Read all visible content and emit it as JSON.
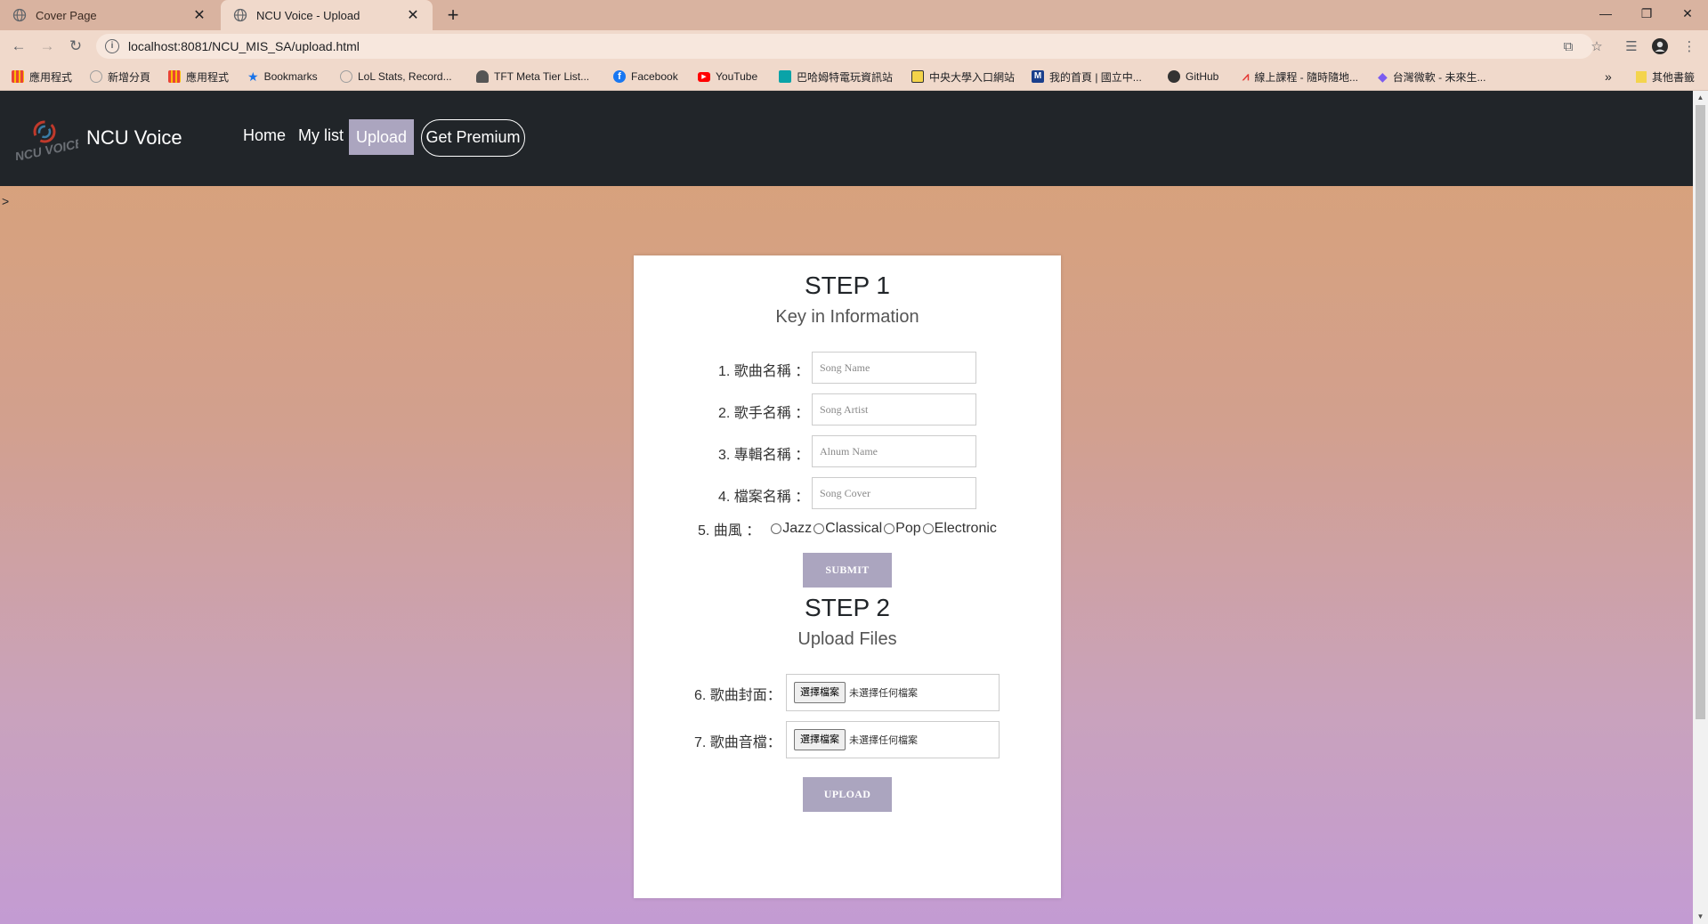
{
  "browser": {
    "tabs": [
      {
        "title": "Cover Page",
        "active": false
      },
      {
        "title": "NCU Voice - Upload",
        "active": true
      }
    ],
    "new_tab": "+",
    "url": "localhost:8081/NCU_MIS_SA/upload.html",
    "bookmarks": [
      {
        "label": "應用程式",
        "icon": "apps-grid-icon",
        "color": "#ea4335"
      },
      {
        "label": "新增分頁",
        "icon": "globe-icon",
        "color": "#9e9e9e"
      },
      {
        "label": "應用程式",
        "icon": "apps-grid-icon",
        "color": "#ea4335"
      },
      {
        "label": "Bookmarks",
        "icon": "star-icon",
        "color": "#1a73e8"
      },
      {
        "label": "LoL Stats, Record...",
        "icon": "globe-icon",
        "color": "#9e9e9e"
      },
      {
        "label": "TFT Meta Tier List...",
        "icon": "tft-icon",
        "color": "#555555"
      },
      {
        "label": "Facebook",
        "icon": "facebook-icon",
        "color": "#1877f2"
      },
      {
        "label": "YouTube",
        "icon": "youtube-icon",
        "color": "#ff0000"
      },
      {
        "label": "巴哈姆特電玩資訊站",
        "icon": "bahamut-icon",
        "color": "#0aa3a8"
      },
      {
        "label": "中央大學入口網站",
        "icon": "ncu-icon",
        "color": "#333333"
      },
      {
        "label": "我的首頁 | 國立中...",
        "icon": "m-icon",
        "color": "#1a3f8c"
      },
      {
        "label": "GitHub",
        "icon": "github-icon",
        "color": "#333333"
      },
      {
        "label": "線上課程 - 隨時隨地...",
        "icon": "course-icon",
        "color": "#e53935"
      },
      {
        "label": "台灣微軟 - 未來生...",
        "icon": "diamond-icon",
        "color": "#7b5cf0"
      }
    ],
    "overflow": "»",
    "other_bookmarks": "其他書籤"
  },
  "navbar": {
    "brand": "NCU Voice",
    "links": [
      {
        "label": "Home",
        "active": false
      },
      {
        "label": "My list",
        "active": false
      },
      {
        "label": "Upload",
        "active": true
      }
    ],
    "premium": "Get Premium"
  },
  "stray_text": ">",
  "step1": {
    "title": "STEP 1",
    "subtitle": "Key in Information",
    "fields": [
      {
        "label": "1. 歌曲名稱 ：",
        "placeholder": "Song Name"
      },
      {
        "label": "2. 歌手名稱 ：",
        "placeholder": "Song Artist"
      },
      {
        "label": "3. 專輯名稱 ：",
        "placeholder": "Alnum Name"
      },
      {
        "label": "4. 檔案名稱 ：",
        "placeholder": "Song Cover"
      }
    ],
    "genre_label": "5. 曲風 ：",
    "genres": [
      "Jazz",
      "Classical",
      "Pop",
      "Electronic"
    ],
    "submit": "SUBMIT"
  },
  "step2": {
    "title": "STEP 2",
    "subtitle": "Upload Files",
    "files": [
      {
        "label": "6. 歌曲封面：",
        "button": "選擇檔案",
        "status": "未選擇任何檔案"
      },
      {
        "label": "7. 歌曲音檔：",
        "button": "選擇檔案",
        "status": "未選擇任何檔案"
      }
    ],
    "upload": "UPLOAD"
  }
}
